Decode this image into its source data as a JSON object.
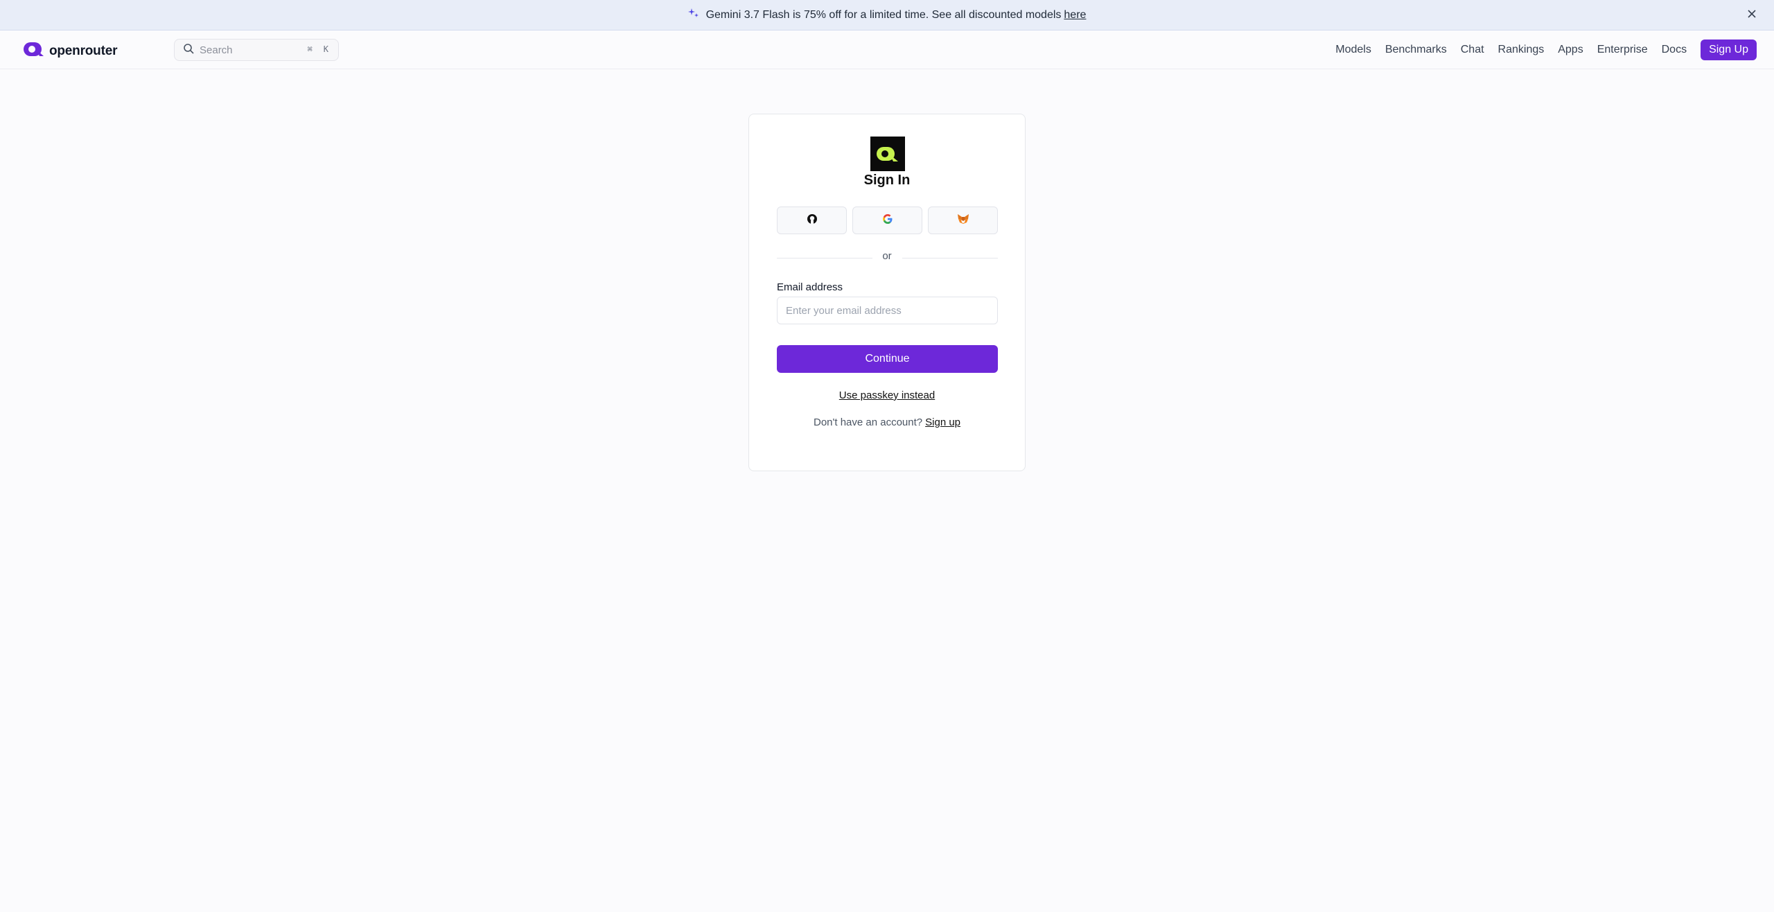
{
  "banner": {
    "text": "Gemini 3.7 Flash is 75% off for a limited time. See all discounted models",
    "link": "here",
    "icon": "sparkles-icon"
  },
  "header": {
    "brand": "openrouter",
    "search_placeholder": "Search",
    "shortcut_key1": "⌘",
    "shortcut_key2": "K",
    "nav": [
      "Models",
      "Benchmarks",
      "Chat",
      "Rankings",
      "Apps",
      "Enterprise",
      "Docs"
    ],
    "signup": "Sign Up"
  },
  "card": {
    "title": "Sign In",
    "oauth": [
      "github-icon",
      "google-icon",
      "metamask-icon"
    ],
    "divider_text": "or",
    "email_label": "Email address",
    "email_placeholder": "Enter your email address",
    "continue": "Continue",
    "passkey": "Use passkey instead",
    "no_account": "Don't have an account?",
    "signup_link": "Sign up"
  },
  "colors": {
    "accent": "#6d28d9",
    "banner_bg": "#e8edf8",
    "logo_bg": "#0b0b0b",
    "logo_mark": "#c6f24e"
  }
}
